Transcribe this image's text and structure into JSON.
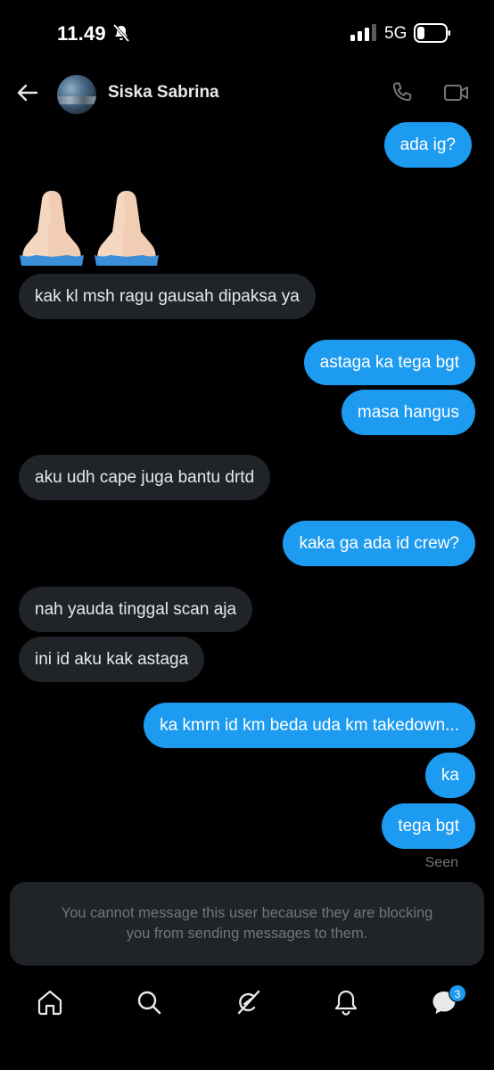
{
  "status_bar": {
    "time": "11.49",
    "network": "5G"
  },
  "header": {
    "contact_name": "Siska Sabrina"
  },
  "messages": [
    {
      "text": "ada ig?",
      "direction": "sent"
    },
    {
      "text": "🙏🏻🙏🏻",
      "direction": "received",
      "type": "emoji"
    },
    {
      "text": "kak kl msh ragu gausah dipaksa ya",
      "direction": "received"
    },
    {
      "text": "astaga ka tega bgt",
      "direction": "sent"
    },
    {
      "text": "masa hangus",
      "direction": "sent"
    },
    {
      "text": "aku udh cape juga bantu drtd",
      "direction": "received"
    },
    {
      "text": "kaka ga ada id crew?",
      "direction": "sent"
    },
    {
      "text": "nah yauda tinggal scan aja",
      "direction": "received"
    },
    {
      "text": "ini id aku kak astaga",
      "direction": "received"
    },
    {
      "text": "ka kmrn id km beda uda km takedown...",
      "direction": "sent"
    },
    {
      "text": "ka",
      "direction": "sent"
    },
    {
      "text": "tega bgt",
      "direction": "sent"
    }
  ],
  "seen_label": "Seen",
  "blocked_notice": {
    "line1": "You cannot message this user because they are blocking",
    "line2": "you from sending messages to them."
  },
  "bottom_nav": {
    "items": [
      "home-icon",
      "search-icon",
      "grok-icon",
      "notifications-icon",
      "messages-icon"
    ],
    "messages_badge": "3"
  },
  "colors": {
    "sent_bubble": "#1d9bf0",
    "received_bubble": "#202327",
    "background": "#000000",
    "muted_text": "#71767b"
  }
}
